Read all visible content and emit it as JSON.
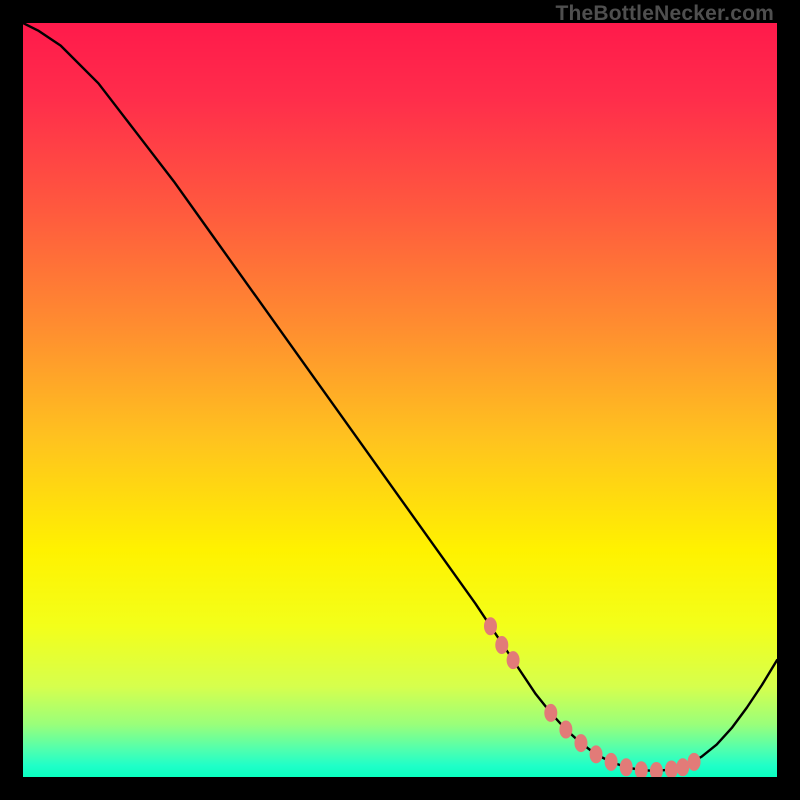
{
  "watermark": "TheBottleNecker.com",
  "gradient_stops": [
    {
      "offset": 0.0,
      "color": "#ff1a4b"
    },
    {
      "offset": 0.1,
      "color": "#ff2d4b"
    },
    {
      "offset": 0.25,
      "color": "#ff5a3e"
    },
    {
      "offset": 0.4,
      "color": "#ff8c30"
    },
    {
      "offset": 0.55,
      "color": "#ffc21f"
    },
    {
      "offset": 0.7,
      "color": "#fff200"
    },
    {
      "offset": 0.8,
      "color": "#f3ff1a"
    },
    {
      "offset": 0.88,
      "color": "#d6ff4d"
    },
    {
      "offset": 0.93,
      "color": "#9aff7a"
    },
    {
      "offset": 0.965,
      "color": "#4dffb0"
    },
    {
      "offset": 0.985,
      "color": "#1fffc8"
    },
    {
      "offset": 1.0,
      "color": "#0affc0"
    }
  ],
  "curve_color": "#000000",
  "marker_color": "#e27b78",
  "chart_data": {
    "type": "line",
    "title": "",
    "xlabel": "",
    "ylabel": "",
    "xlim": [
      0,
      100
    ],
    "ylim": [
      0,
      100
    ],
    "x": [
      0,
      2,
      5,
      10,
      15,
      20,
      25,
      30,
      35,
      40,
      45,
      50,
      55,
      60,
      62,
      65,
      68,
      70,
      72,
      74,
      76,
      78,
      80,
      82,
      84,
      86,
      88,
      90,
      92,
      94,
      96,
      98,
      100
    ],
    "y": [
      100,
      99,
      97,
      92,
      85.5,
      79,
      72,
      65,
      58,
      51,
      44,
      37,
      30,
      23,
      20,
      15.5,
      11,
      8.5,
      6.3,
      4.5,
      3.0,
      2.0,
      1.3,
      0.9,
      0.8,
      1.0,
      1.6,
      2.7,
      4.3,
      6.5,
      9.2,
      12.2,
      15.5
    ],
    "markers_x": [
      62.0,
      63.5,
      65.0,
      70.0,
      72.0,
      74.0,
      76.0,
      78.0,
      80.0,
      82.0,
      84.0,
      86.0,
      87.5,
      89.0
    ],
    "markers_y": [
      20.0,
      17.5,
      15.5,
      8.5,
      6.3,
      4.5,
      3.0,
      2.0,
      1.3,
      0.9,
      0.8,
      1.0,
      1.3,
      2.0
    ]
  }
}
